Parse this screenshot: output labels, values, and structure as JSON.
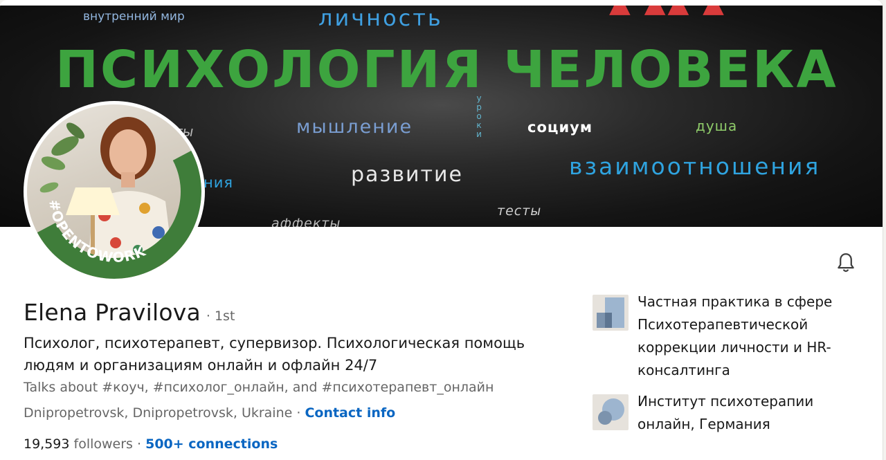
{
  "banner": {
    "words": {
      "inner_world": "внутренний мир",
      "personality": "личность",
      "title": "ПСИХОЛОГИЯ ЧЕЛОВЕКА",
      "thinking": "мышление",
      "lessons": "уроки",
      "society": "социум",
      "soul": "душа",
      "development": "развитие",
      "relationships": "взаимоотношения",
      "ty_fragment": "ты",
      "niya_fragment": "ния",
      "tests": "тесты",
      "affects": "аффекты"
    }
  },
  "avatar": {
    "badge_text": "#OPENTOWORK",
    "badge_color": "#3f7d3a"
  },
  "profile": {
    "name": "Elena Pravilova",
    "degree": "· 1st",
    "headline": "Психолог, психотерапевт, супервизор. Психологическая помощь людям и организациям онлайн и офлайн 24/7",
    "talks_about": "Talks about #коуч, #психолог_онлайн, and #психотерапевт_онлайн",
    "location": "Dnipropetrovsk, Dnipropetrovsk, Ukraine",
    "separator": " · ",
    "contact_info": "Contact info",
    "followers_count": "19,593",
    "followers_label": " followers",
    "stats_separator": "  · ",
    "connections": "500+ connections"
  },
  "experience": [
    {
      "title": "Частная практика в сфере Психотерапевтической коррекции личности и HR-консалтинга",
      "logo_icon": "company-logo-icon"
    },
    {
      "title": "Институт психотерапии онлайн, Германия",
      "logo_icon": "school-logo-icon"
    }
  ],
  "icons": {
    "bell": "bell-icon"
  },
  "colors": {
    "link": "#0a66c2",
    "open_to_work": "#3f7d3a",
    "title_green": "#3da43f"
  }
}
